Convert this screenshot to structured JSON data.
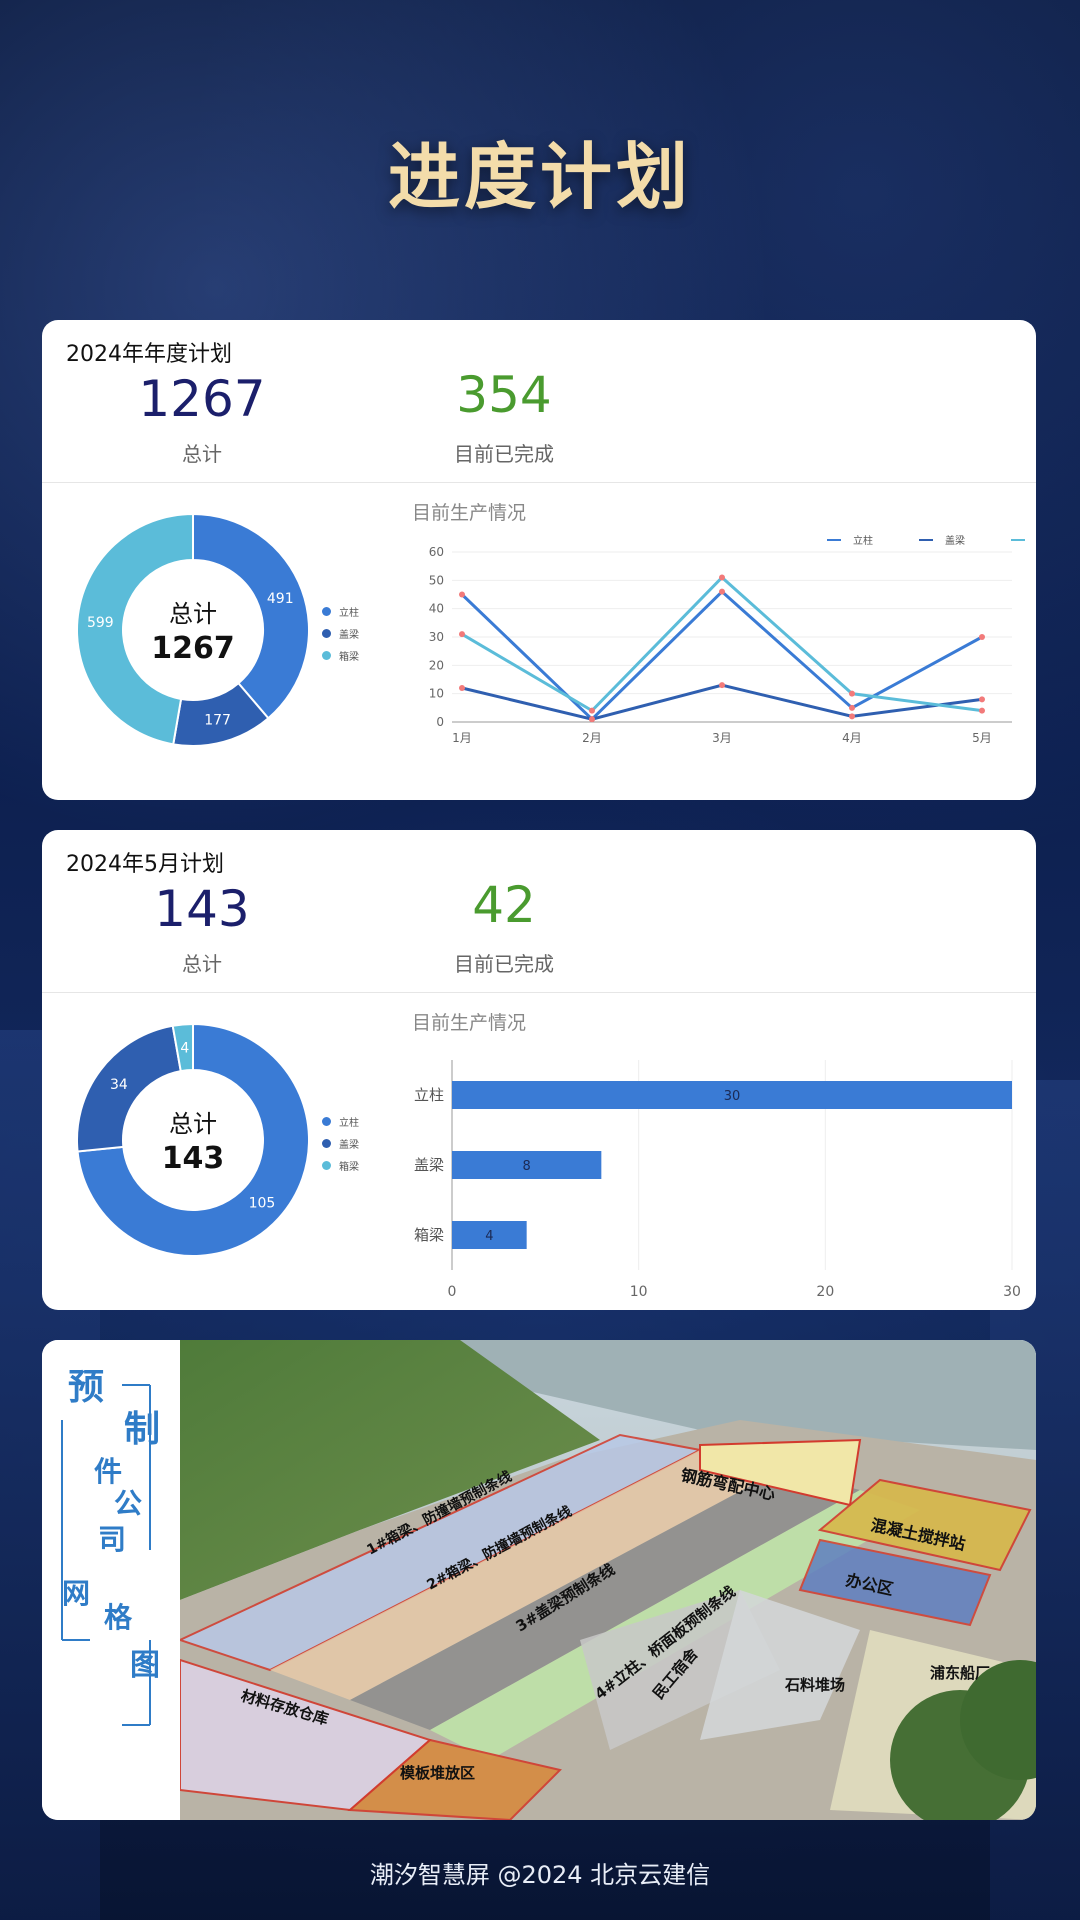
{
  "page": {
    "title": "进度计划",
    "footer": "潮汐智慧屏 @2024 北京云建信"
  },
  "colors": {
    "lizhu": "#3a7bd5",
    "gailiang": "#2f5fb0",
    "xiangliang": "#5bbcd9",
    "done": "#4a9b2f",
    "total": "#1b1f6b",
    "title": "#f3dcaa"
  },
  "annual": {
    "title": "2024年年度计划",
    "total": "1267",
    "total_label": "总计",
    "done": "354",
    "done_label": "目前已完成",
    "donut_center_label": "总计",
    "donut_center_value": "1267",
    "legend": [
      "立柱",
      "盖梁",
      "箱梁"
    ],
    "chart_title": "目前生产情况"
  },
  "monthly": {
    "title": "2024年5月计划",
    "total": "143",
    "total_label": "总计",
    "done": "42",
    "done_label": "目前已完成",
    "donut_center_label": "总计",
    "donut_center_value": "143",
    "legend": [
      "立柱",
      "盖梁",
      "箱梁"
    ],
    "chart_title": "目前生产情况"
  },
  "map": {
    "side_chars": [
      "预",
      "制",
      "件",
      "公",
      "司",
      "网",
      "格",
      "图"
    ],
    "labels": [
      "钢筋弯配中心",
      "混凝土搅拌站",
      "办公区",
      "1#箱梁、防撞墙预制条线",
      "2#箱梁、防撞墙预制条线",
      "3#盖梁预制条线",
      "4#立柱、桥面板预制条线",
      "民工宿舍",
      "石料堆场",
      "浦东船厂",
      "材料存放仓库",
      "模板堆放区"
    ]
  },
  "chart_data": [
    {
      "type": "pie",
      "title": "",
      "categories": [
        "立柱",
        "盖梁",
        "箱梁"
      ],
      "values": [
        491,
        177,
        599
      ]
    },
    {
      "type": "line",
      "title": "目前生产情况",
      "categories": [
        "1月",
        "2月",
        "3月",
        "4月",
        "5月"
      ],
      "series": [
        {
          "name": "立柱",
          "values": [
            45,
            1,
            46,
            5,
            30
          ]
        },
        {
          "name": "盖梁",
          "values": [
            12,
            1,
            13,
            2,
            8
          ]
        },
        {
          "name": "箱梁",
          "values": [
            31,
            4,
            51,
            10,
            4
          ]
        }
      ],
      "ylim": [
        0,
        60
      ],
      "yticks": [
        0,
        10,
        20,
        30,
        40,
        50,
        60
      ],
      "legend": "top-right",
      "grid": true
    },
    {
      "type": "pie",
      "title": "",
      "categories": [
        "立柱",
        "盖梁",
        "箱梁"
      ],
      "values": [
        105,
        34,
        4
      ]
    },
    {
      "type": "bar",
      "orientation": "horizontal",
      "title": "目前生产情况",
      "categories": [
        "立柱",
        "盖梁",
        "箱梁"
      ],
      "values": [
        30,
        8,
        4
      ],
      "xlim": [
        0,
        30
      ],
      "xticks": [
        0,
        10,
        20,
        30
      ],
      "grid": true
    }
  ]
}
